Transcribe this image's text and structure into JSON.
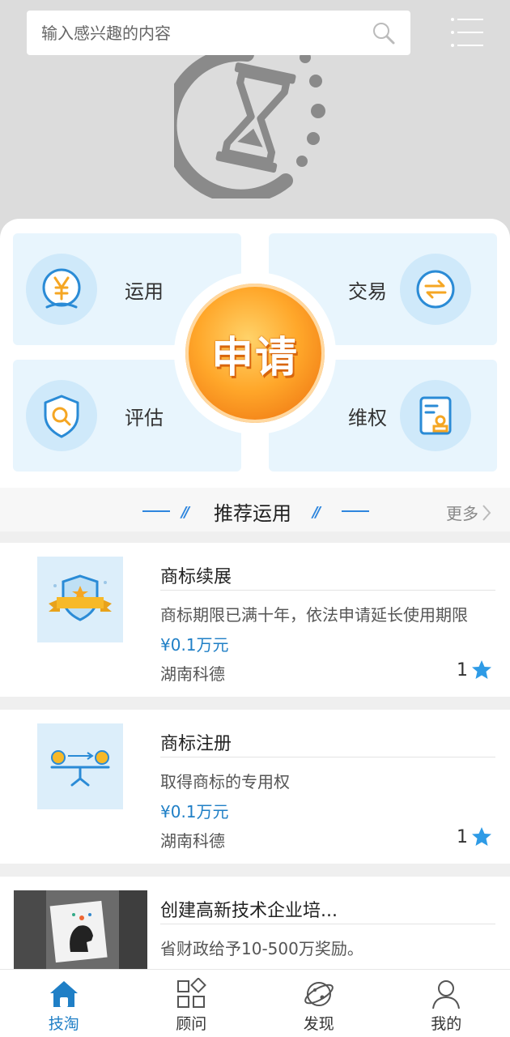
{
  "search": {
    "placeholder": "输入感兴趣的内容"
  },
  "services": {
    "use": "运用",
    "trade": "交易",
    "assess": "评估",
    "protect": "维权",
    "apply": "申请"
  },
  "section": {
    "title": "推荐运用",
    "more": "更多"
  },
  "items": [
    {
      "title": "商标续展",
      "desc": "商标期限已满十年，依法申请延长使用期限",
      "price": "¥0.1万元",
      "org": "湖南科德",
      "rating": "1"
    },
    {
      "title": "商标注册",
      "desc": "取得商标的专用权",
      "price": "¥0.1万元",
      "org": "湖南科德",
      "rating": "1"
    },
    {
      "title": "创建高新技术企业培...",
      "desc": "省财政给予10-500万奖励。"
    }
  ],
  "tabs": [
    {
      "label": "技淘",
      "icon": "home-icon"
    },
    {
      "label": "顾问",
      "icon": "grid-icon"
    },
    {
      "label": "发现",
      "icon": "planet-icon"
    },
    {
      "label": "我的",
      "icon": "user-icon"
    }
  ],
  "colors": {
    "accent": "#1f7fc6",
    "apply_orange": "#f7931e",
    "tile_bg": "#e8f5fd"
  }
}
